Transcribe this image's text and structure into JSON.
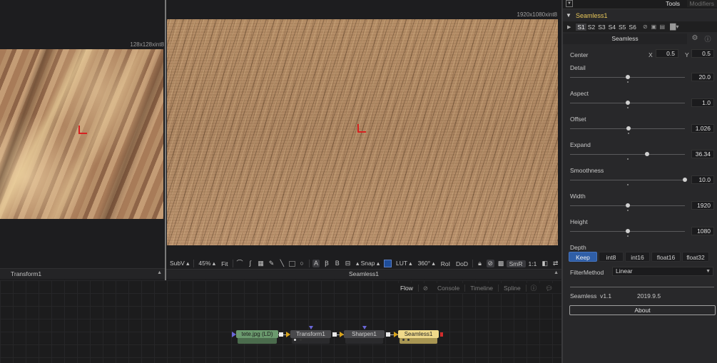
{
  "left_viewer": {
    "resolution": "128x128xint8",
    "footer_label": "Transform1"
  },
  "main_viewer": {
    "resolution": "1920x1080xint8",
    "footer_label": "Seamless1",
    "toolbar": {
      "subview": "SubV",
      "zoom": "45%",
      "fit": "Fit",
      "channel_a": "A",
      "snap": "Snap",
      "lut": "LUT",
      "view_360": "360°",
      "roi": "RoI",
      "dod": "DoD",
      "smr": "SmR",
      "ratio": "1:1"
    }
  },
  "flow": {
    "tabs": [
      "Flow",
      "Console",
      "Timeline",
      "Spline"
    ],
    "active_tab": "Flow",
    "nodes": [
      {
        "label": "tete.jpg (LD)",
        "kind": "loader"
      },
      {
        "label": "Transform1",
        "kind": "tool"
      },
      {
        "label": "Sharpen1",
        "kind": "tool"
      },
      {
        "label": "Seamless1",
        "kind": "active"
      }
    ]
  },
  "inspector": {
    "tabs": {
      "tools": "Tools",
      "modifiers": "Modifiers"
    },
    "tool_name": "Seamless1",
    "presets": [
      "S1",
      "S2",
      "S3",
      "S4",
      "S5",
      "S6"
    ],
    "selected_preset": "S1",
    "control_tab": "Seamless",
    "center": {
      "label": "Center",
      "x_label": "X",
      "x": "0.5",
      "y_label": "Y",
      "y": "0.5"
    },
    "sliders": [
      {
        "label": "Detail",
        "value": "20.0",
        "level": 0.5,
        "default": 0.5
      },
      {
        "label": "Aspect",
        "value": "1.0",
        "level": 0.5,
        "default": 0.5
      },
      {
        "label": "Offset",
        "value": "1.026",
        "level": 0.51,
        "default": 0.51
      },
      {
        "label": "Expand",
        "value": "36.34",
        "level": 0.67,
        "default": 0.5
      },
      {
        "label": "Smoothness",
        "value": "10.0",
        "level": 1.0,
        "default": 0.5
      },
      {
        "label": "Width",
        "value": "1920",
        "level": 0.5,
        "default": 0.5
      },
      {
        "label": "Height",
        "value": "1080",
        "level": 0.5,
        "default": 0.5
      }
    ],
    "depth": {
      "label": "Depth",
      "options": [
        "Keep",
        "int8",
        "int16",
        "float16",
        "float32"
      ],
      "selected": "Keep"
    },
    "filter": {
      "label": "FilterMethod",
      "value": "Linear"
    },
    "version": {
      "name": "Seamless",
      "ver": "v1.1",
      "date": "2019.9.5"
    },
    "about_label": "About"
  },
  "colors": {
    "accent_blue": "#2f5ea7",
    "tool_name": "#e8c75a",
    "active_node": "#efd98a",
    "loader_node": "#6b9a6e",
    "crosshair": "#d62020"
  }
}
